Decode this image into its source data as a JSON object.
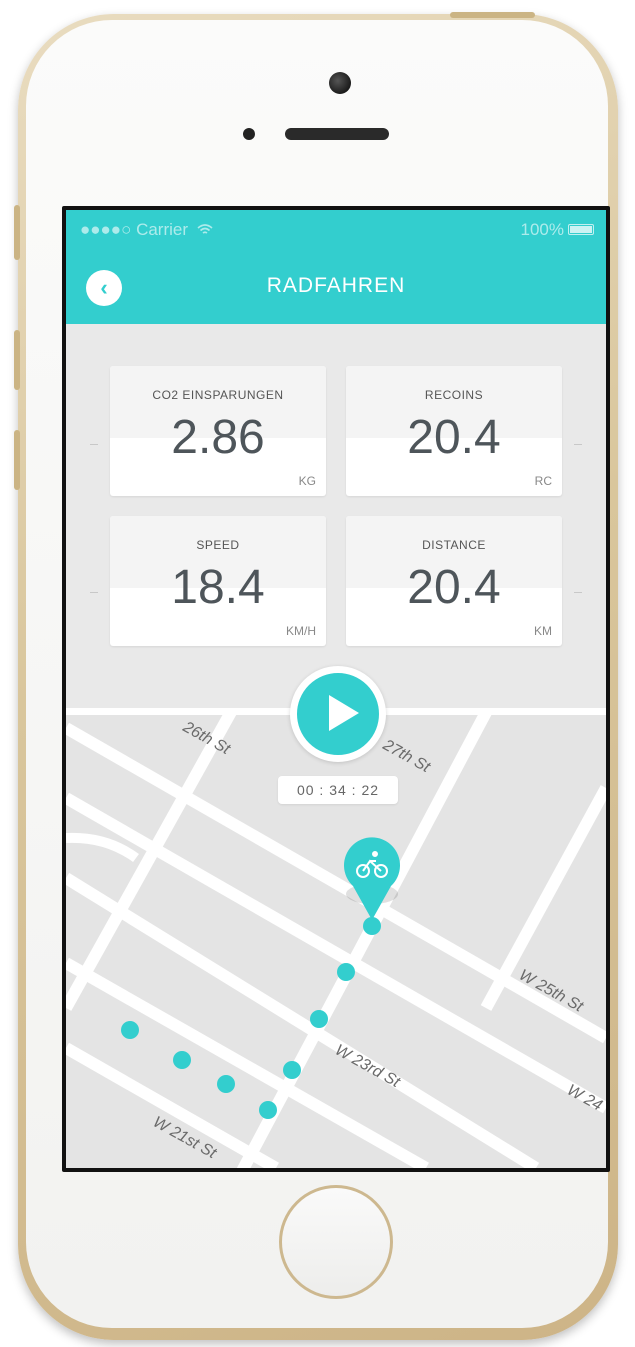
{
  "status_bar": {
    "signal": "●●●●○",
    "carrier": "Carrier",
    "wifi_icon": "wifi-icon",
    "battery": "100%"
  },
  "header": {
    "back_icon": "chevron-left-icon",
    "back_glyph": "‹",
    "title": "RADFAHREN"
  },
  "stats": [
    {
      "label": "CO2 EINSPARUNGEN",
      "value": "2.86",
      "unit": "KG"
    },
    {
      "label": "RECOINS",
      "value": "20.4",
      "unit": "RC"
    },
    {
      "label": "SPEED",
      "value": "18.4",
      "unit": "KM/H"
    },
    {
      "label": "DISTANCE",
      "value": "20.4",
      "unit": "KM"
    }
  ],
  "player": {
    "play_icon": "play-icon",
    "timer": "00 : 34 : 22"
  },
  "map": {
    "streets": [
      "26th St",
      "27th St",
      "W 25th St",
      "W 23rd St",
      "W 24",
      "W 21st St"
    ],
    "marker_icon": "bicycle-icon",
    "colors": {
      "accent": "#33cece",
      "road": "#ffffff",
      "block": "#e4e4e4"
    }
  }
}
